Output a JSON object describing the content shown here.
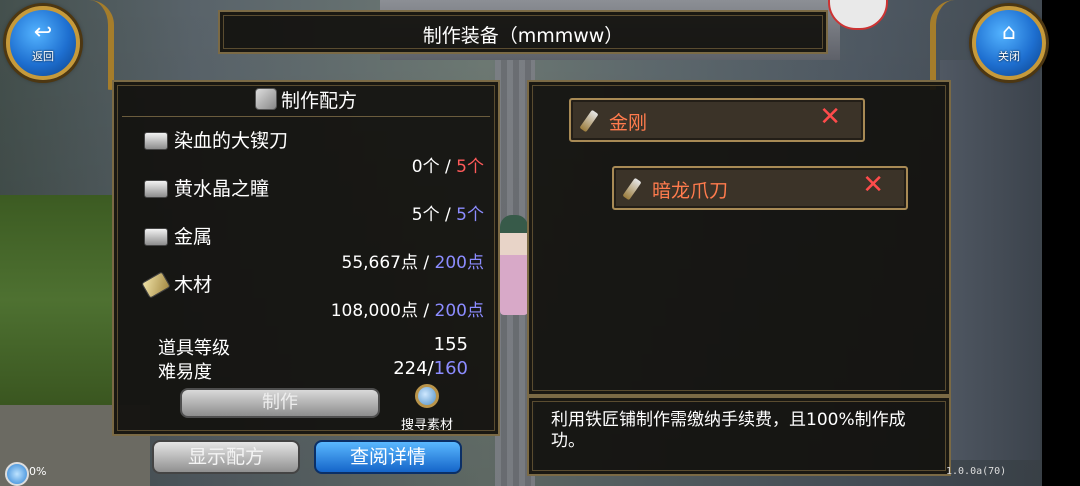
{
  "nav": {
    "back_label": "返回",
    "close_label": "关闭"
  },
  "window": {
    "title": "制作装备（mmmww）"
  },
  "recipe": {
    "header": "制作配方",
    "materials": [
      {
        "name": "染血的大锲刀",
        "have": "0个",
        "sep": " / ",
        "need": "5个",
        "need_color": "red",
        "icon": "metal-ingot-icon"
      },
      {
        "name": "黄水晶之瞳",
        "have": "5个",
        "sep": " / ",
        "need": "5个",
        "need_color": "blue",
        "icon": "metal-ingot-icon"
      },
      {
        "name": "金属",
        "have": "55,667点",
        "sep": " / ",
        "need": "200点",
        "need_color": "blue",
        "icon": "metal-ingot-icon"
      },
      {
        "name": "木材",
        "have": "108,000点",
        "sep": " / ",
        "need": "200点",
        "need_color": "blue",
        "icon": "wood-icon"
      }
    ],
    "item_level_label": "道具等级",
    "item_level_value": "155",
    "difficulty_label": "难易度",
    "difficulty_current": "224/",
    "difficulty_required": "160",
    "make_label": "制作",
    "search_label": "搜寻素材"
  },
  "buttons": {
    "show_recipe": "显示配方",
    "view_detail": "查阅详情"
  },
  "equipment": [
    {
      "name": "金刚",
      "icon": "sword-icon"
    },
    {
      "name": "暗龙爪刀",
      "icon": "sword-icon"
    }
  ],
  "remove_icon": "✕",
  "info_text": "利用铁匠铺制作需缴纳手续费，且100%制作成功。",
  "status": {
    "percent": "0%"
  },
  "version": "1.0.0a(70)",
  "colors": {
    "red": "#ff5a5a",
    "blue": "#8c8cff",
    "gold_border": "#a88a55",
    "chip_text": "#ff7b4d"
  }
}
